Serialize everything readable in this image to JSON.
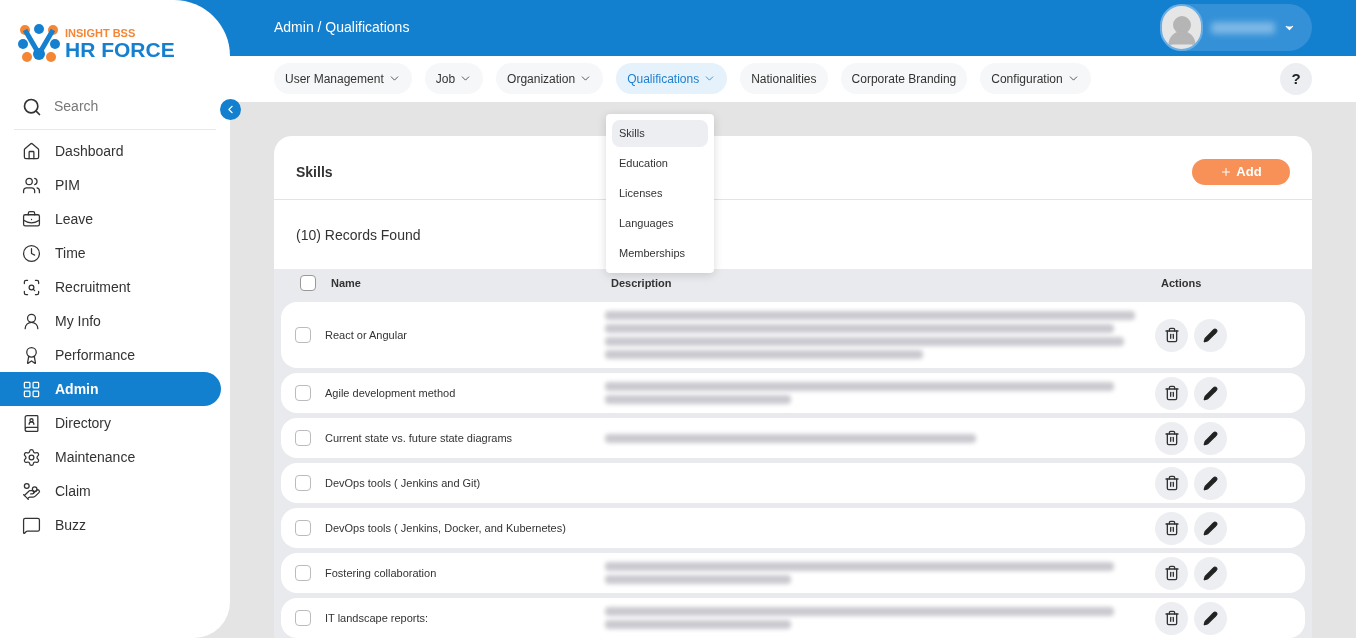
{
  "logo": {
    "top": "INSIGHT BSS",
    "bottom": "HR FORCE"
  },
  "sidebar": {
    "search": {
      "placeholder": "Search"
    },
    "items": [
      {
        "label": "Dashboard",
        "selected": false
      },
      {
        "label": "PIM",
        "selected": false
      },
      {
        "label": "Leave",
        "selected": false
      },
      {
        "label": "Time",
        "selected": false
      },
      {
        "label": "Recruitment",
        "selected": false
      },
      {
        "label": "My Info",
        "selected": false
      },
      {
        "label": "Performance",
        "selected": false
      },
      {
        "label": "Admin",
        "selected": true
      },
      {
        "label": "Directory",
        "selected": false
      },
      {
        "label": "Maintenance",
        "selected": false
      },
      {
        "label": "Claim",
        "selected": false
      },
      {
        "label": "Buzz",
        "selected": false
      }
    ]
  },
  "header": {
    "breadcrumb": "Admin / Qualifications"
  },
  "tabs": [
    {
      "label": "User Management",
      "dropdown": true,
      "selected": false
    },
    {
      "label": "Job",
      "dropdown": true,
      "selected": false
    },
    {
      "label": "Organization",
      "dropdown": true,
      "selected": false
    },
    {
      "label": "Qualifications",
      "dropdown": true,
      "selected": true
    },
    {
      "label": "Nationalities",
      "dropdown": false,
      "selected": false
    },
    {
      "label": "Corporate Branding",
      "dropdown": false,
      "selected": false
    },
    {
      "label": "Configuration",
      "dropdown": true,
      "selected": false
    }
  ],
  "help_button": "?",
  "dropdown_menu": [
    {
      "label": "Skills",
      "selected": true
    },
    {
      "label": "Education",
      "selected": false
    },
    {
      "label": "Licenses",
      "selected": false
    },
    {
      "label": "Languages",
      "selected": false
    },
    {
      "label": "Memberships",
      "selected": false
    }
  ],
  "card": {
    "title": "Skills",
    "add_button": "Add",
    "records": "(10) Records Found"
  },
  "table": {
    "columns": [
      "Name",
      "Description",
      "Actions"
    ],
    "all_checked": false,
    "rows": [
      {
        "name": "React or Angular",
        "kind": "long",
        "checked": false
      },
      {
        "name": "Agile development method",
        "kind": "medium",
        "checked": false
      },
      {
        "name": "Current state vs. future state diagrams",
        "kind": "short",
        "checked": false
      },
      {
        "name": "DevOps tools ( Jenkins and Git)",
        "kind": "empty",
        "checked": false
      },
      {
        "name": "DevOps tools ( Jenkins, Docker, and Kubernetes)",
        "kind": "empty",
        "checked": false
      },
      {
        "name": "Fostering collaboration",
        "kind": "medium",
        "checked": false
      },
      {
        "name": "IT landscape reports:",
        "kind": "medium",
        "checked": false
      }
    ]
  }
}
